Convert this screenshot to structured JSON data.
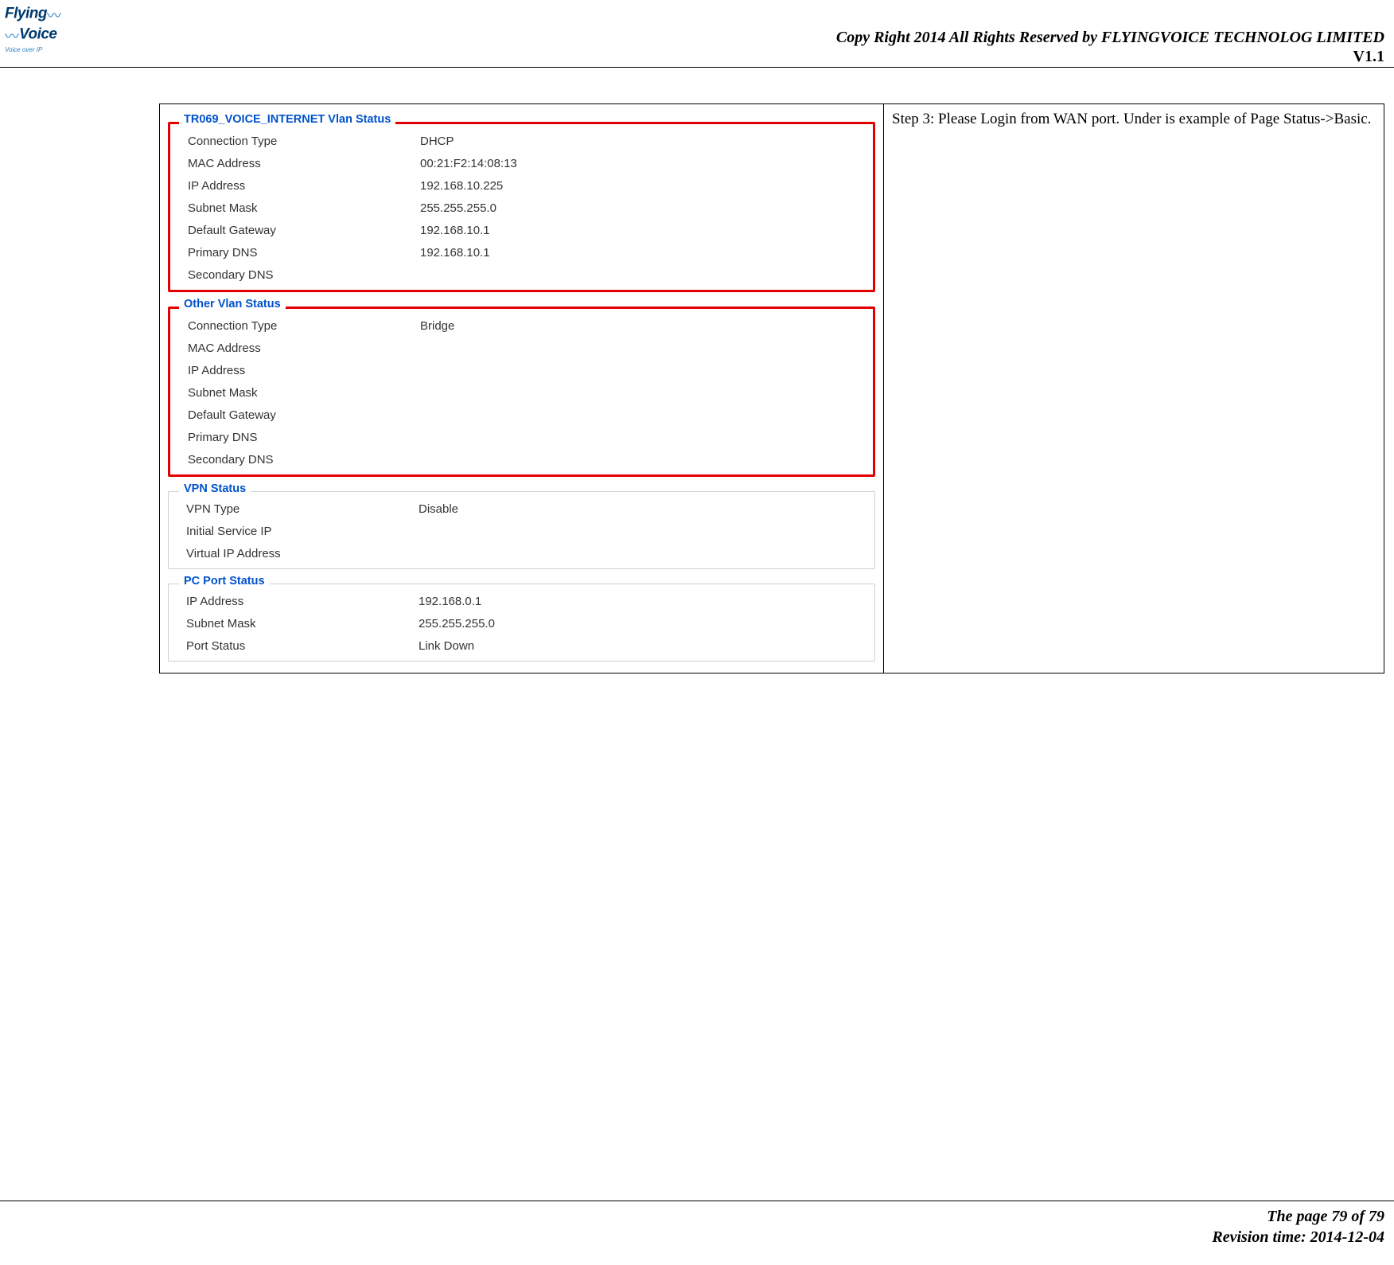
{
  "header": {
    "logo_line1": "Flying",
    "logo_line2": "Voice",
    "logo_tagline": "Voice over IP",
    "copyright": "Copy Right 2014 All Rights Reserved by FLYINGVOICE TECHNOLOG LIMITED",
    "version": "V1.1"
  },
  "footer": {
    "page": "The page 79 of 79",
    "revision": "Revision time: 2014-12-04"
  },
  "right_text": "Step 3: Please Login from WAN port.   Under is example of Page Status->Basic.",
  "groups": [
    {
      "title": "TR069_VOICE_INTERNET Vlan Status",
      "highlight": true,
      "rows": [
        {
          "k": "Connection Type",
          "v": "DHCP"
        },
        {
          "k": "MAC Address",
          "v": "00:21:F2:14:08:13"
        },
        {
          "k": "IP Address",
          "v": "192.168.10.225"
        },
        {
          "k": "Subnet Mask",
          "v": "255.255.255.0"
        },
        {
          "k": "Default Gateway",
          "v": "192.168.10.1"
        },
        {
          "k": "Primary DNS",
          "v": "192.168.10.1"
        },
        {
          "k": "Secondary DNS",
          "v": ""
        }
      ]
    },
    {
      "title": "Other Vlan Status",
      "highlight": true,
      "rows": [
        {
          "k": "Connection Type",
          "v": "Bridge"
        },
        {
          "k": "MAC Address",
          "v": ""
        },
        {
          "k": "IP Address",
          "v": ""
        },
        {
          "k": "Subnet Mask",
          "v": ""
        },
        {
          "k": "Default Gateway",
          "v": ""
        },
        {
          "k": "Primary DNS",
          "v": ""
        },
        {
          "k": "Secondary DNS",
          "v": ""
        }
      ]
    },
    {
      "title": "VPN Status",
      "highlight": false,
      "rows": [
        {
          "k": "VPN Type",
          "v": "Disable"
        },
        {
          "k": "Initial Service IP",
          "v": ""
        },
        {
          "k": "Virtual IP Address",
          "v": ""
        }
      ]
    },
    {
      "title": "PC Port Status",
      "highlight": false,
      "rows": [
        {
          "k": "IP Address",
          "v": "192.168.0.1"
        },
        {
          "k": "Subnet Mask",
          "v": "255.255.255.0"
        },
        {
          "k": "Port Status",
          "v": "Link Down"
        }
      ]
    }
  ]
}
